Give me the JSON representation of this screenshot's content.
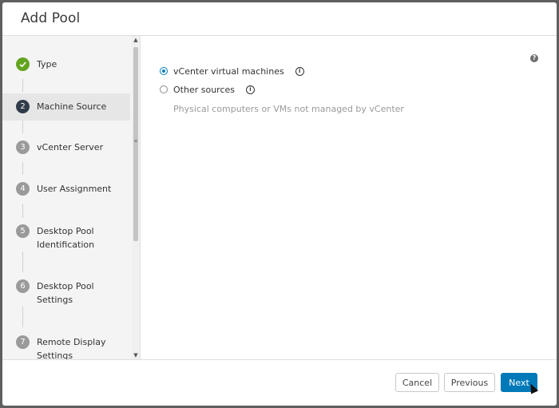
{
  "dialog": {
    "title": "Add Pool"
  },
  "steps": [
    {
      "num": "",
      "label": "Type",
      "state": "done"
    },
    {
      "num": "2",
      "label": "Machine Source",
      "state": "current"
    },
    {
      "num": "3",
      "label": "vCenter Server",
      "state": "pending"
    },
    {
      "num": "4",
      "label": "User Assignment",
      "state": "pending"
    },
    {
      "num": "5",
      "label_line1": "Desktop Pool",
      "label_line2": "Identification",
      "state": "pending"
    },
    {
      "num": "6",
      "label_line1": "Desktop Pool",
      "label_line2": "Settings",
      "state": "pending"
    },
    {
      "num": "7",
      "label_line1": "Remote Display",
      "label_line2": "Settings",
      "state": "pending"
    }
  ],
  "main": {
    "options": [
      {
        "label": "vCenter virtual machines",
        "checked": true
      },
      {
        "label": "Other sources",
        "checked": false
      }
    ],
    "hint": "Physical computers or VMs not managed by vCenter",
    "help_icon": "?"
  },
  "footer": {
    "cancel_label": "Cancel",
    "previous_label": "Previous",
    "next_label": "Next"
  },
  "colors": {
    "accent": "#0079b8",
    "done": "#62a420",
    "current": "#313c4a"
  }
}
